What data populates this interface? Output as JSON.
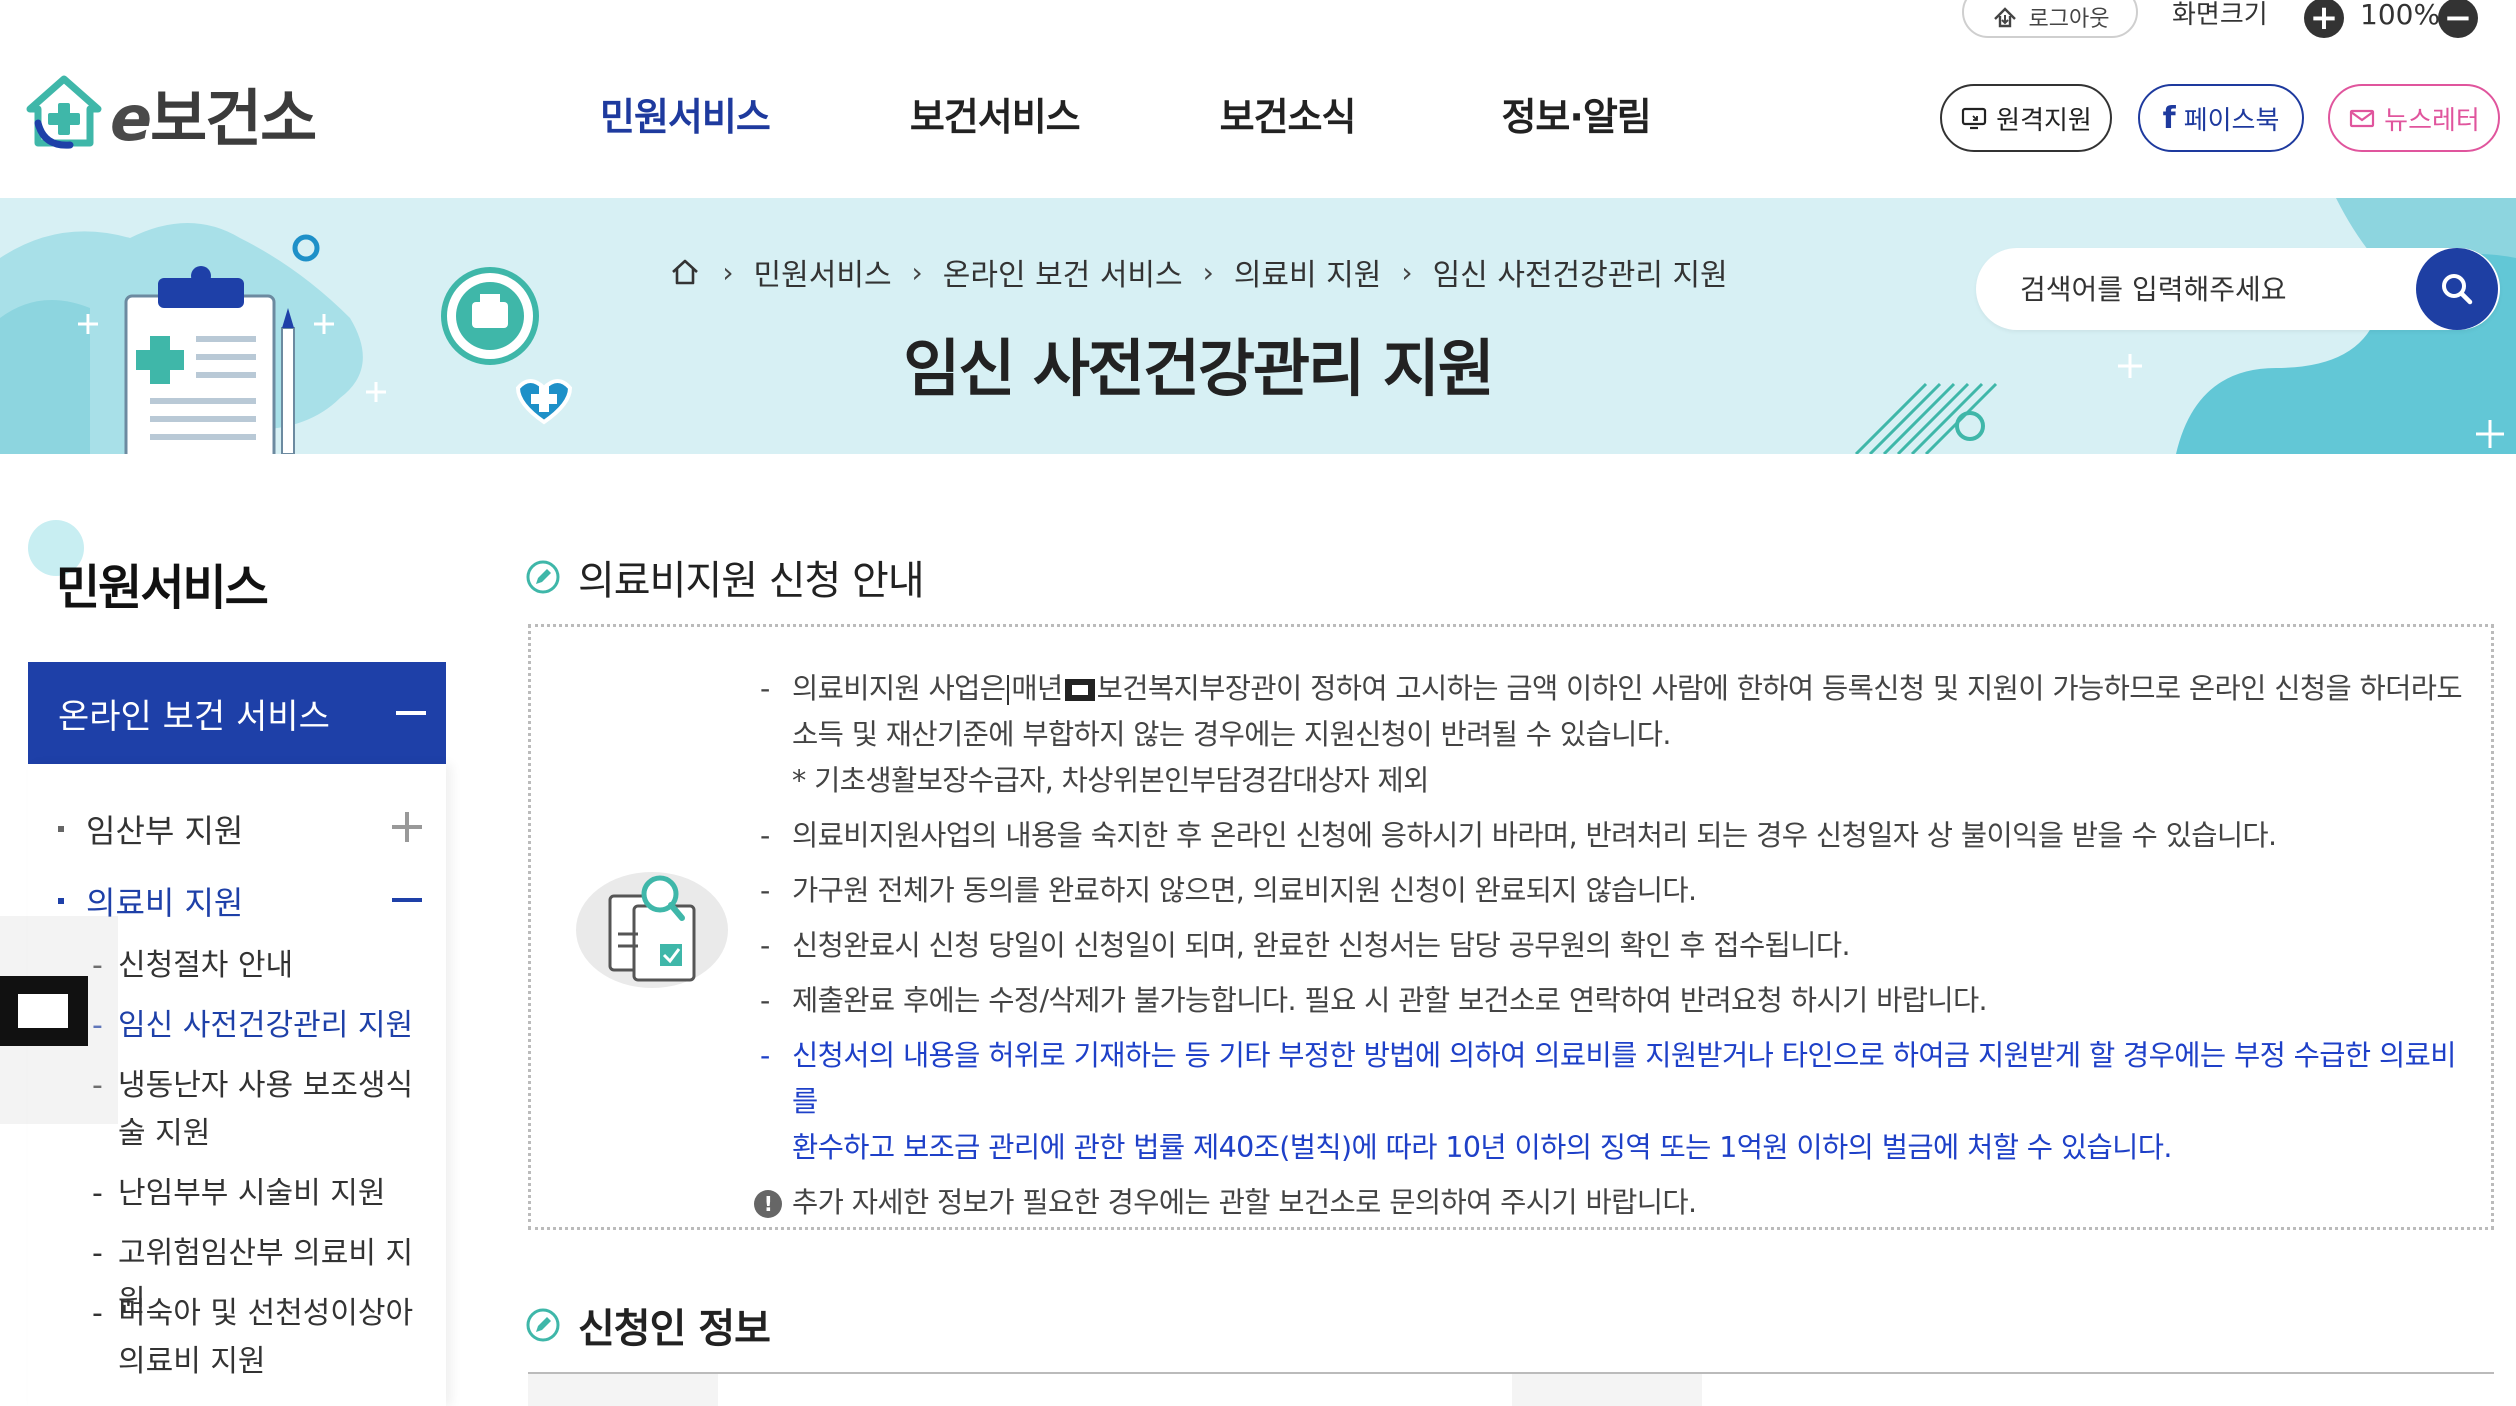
{
  "utility": {
    "logout_label": "로그아웃",
    "screen_size_label": "화면크기",
    "zoom_value": "100%"
  },
  "header": {
    "logo_e": "e",
    "logo_text": "보건소",
    "nav": [
      "민원서비스",
      "보건서비스",
      "보건소식",
      "정보·알림"
    ],
    "remote_label": "원격지원",
    "facebook_label": "페이스북",
    "newsletter_label": "뉴스레터"
  },
  "banner": {
    "breadcrumb": [
      "민원서비스",
      "온라인 보건 서비스",
      "의료비 지원",
      "임신 사전건강관리 지원"
    ],
    "title": "임신 사전건강관리 지원",
    "search_placeholder": "검색어를 입력해주세요"
  },
  "sidebar": {
    "title": "민원서비스",
    "header": "온라인 보건 서비스",
    "items": [
      {
        "label": "임산부 지원"
      },
      {
        "label": "의료비 지원"
      }
    ],
    "subitems": [
      {
        "label": "신청절차 안내"
      },
      {
        "label": "임신 사전건강관리 지원"
      },
      {
        "label": "냉동난자 사용 보조생식술 지원"
      },
      {
        "label": "난임부부 시술비 지원"
      },
      {
        "label": "고위험임산부 의료비 지원"
      },
      {
        "label": "미숙아 및 선천성이상아 의료비 지원"
      }
    ]
  },
  "content": {
    "section1_title": "의료비지원 신청 안내",
    "notice": {
      "l1a": "의료비지원 사업은",
      "l1b": "매년",
      "l1c": "보건복지부장관이 정하여 고시하는 금액 이하인 사람에 한하여 등록신청 및 지원이 가능하므로 온라인 신청을 하더라도",
      "l1d": "소득 및 재산기준에 부합하지 않는 경우에는 지원신청이 반려될 수 있습니다.",
      "l1e": "* 기초생활보장수급자, 차상위본인부담경감대상자 제외",
      "l2": "의료비지원사업의 내용을 숙지한 후 온라인 신청에 응하시기 바라며, 반려처리 되는 경우 신청일자 상 불이익을 받을 수 있습니다.",
      "l3": "가구원 전체가 동의를 완료하지 않으면, 의료비지원 신청이 완료되지 않습니다.",
      "l4": "신청완료시 신청 당일이 신청일이 되며, 완료한 신청서는 담당 공무원의 확인 후 접수됩니다.",
      "l5": "제출완료 후에는 수정/삭제가 불가능합니다. 필요 시 관할 보건소로 연락하여 반려요청 하시기 바랍니다.",
      "l6a": "신청서의 내용을 허위로 기재하는 등 기타 부정한 방법에 의하여 의료비를 지원받거나 타인으로 하여금 지원받게 할 경우에는 부정 수급한 의료비를",
      "l6b": "환수하고 보조금 관리에 관한 법률 제40조(벌칙)에 따라 10년 이하의 징역 또는 1억원 이하의 벌금에 처할 수 있습니다.",
      "l7": "추가 자세한 정보가 필요한 경우에는 관할 보건소로 문의하여 주시기 바랍니다."
    },
    "section2_title": "신청인 정보"
  },
  "colors": {
    "primary": "#1e40a8",
    "banner_bg": "#d7f0f4",
    "accent_teal": "#3fb7a9",
    "notice_blue": "#1e40c8",
    "newsletter_pink": "#e0559d"
  }
}
